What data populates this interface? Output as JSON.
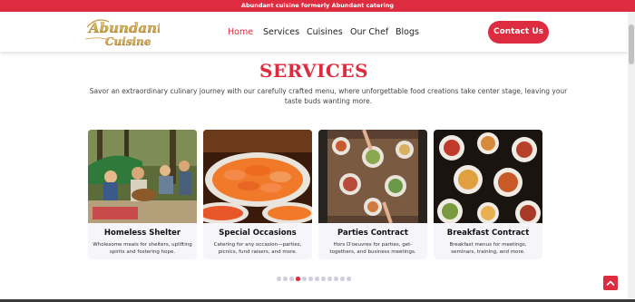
{
  "announcement": "Abundant cuisine formerly Abundant catering",
  "logo": {
    "line1": "Abundant",
    "line2": "Cuisine"
  },
  "nav": {
    "items": [
      {
        "label": "Home",
        "active": true
      },
      {
        "label": "Services",
        "active": false
      },
      {
        "label": "Cuisines",
        "active": false
      },
      {
        "label": "Our Chef",
        "active": false
      },
      {
        "label": "Blogs",
        "active": false
      }
    ]
  },
  "header": {
    "cta_label": "Contact Us"
  },
  "services": {
    "title": "SERVICES",
    "subtitle": "Savor an extraordinary culinary journey with our carefully crafted menu, where unforgettable food creations take center stage, leaving your taste buds wanting more.",
    "cards": [
      {
        "title": "Homeless Shelter",
        "description": "Wholesome meals for shelters, uplifting spirits and fostering hope."
      },
      {
        "title": "Special Occasions",
        "description": "Catering for any occasion—parties, picnics, fund raisers, and more."
      },
      {
        "title": "Parties Contract",
        "description": "Hors D'oeuvres for parties, get-togethers, and business meetings."
      },
      {
        "title": "Breakfast Contract",
        "description": "Breakfast menus for meetings, seminars, training, and more."
      }
    ]
  },
  "carousel": {
    "dot_count": 12,
    "active_index": 3
  },
  "colors": {
    "accent": "#dd2b3f",
    "card_bg": "#f5f5fa"
  },
  "icons": {
    "back_to_top": "chevron-up-icon"
  }
}
